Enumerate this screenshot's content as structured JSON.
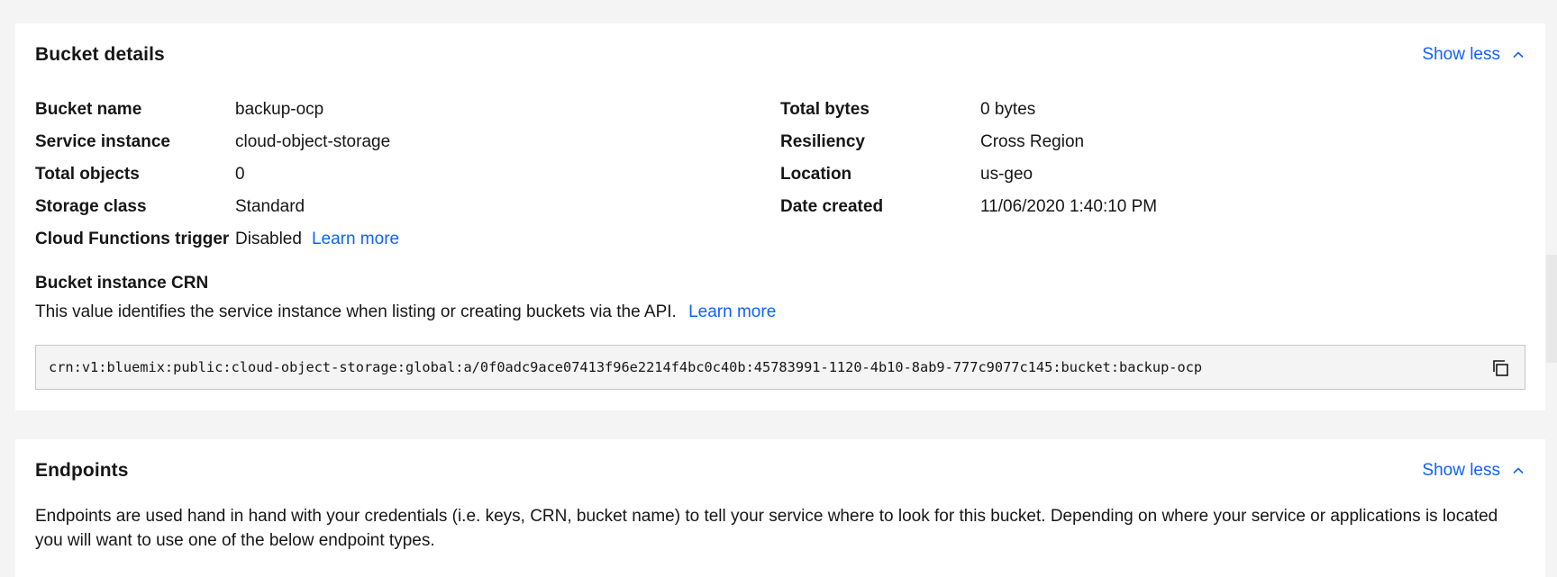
{
  "bucket_details": {
    "title": "Bucket details",
    "toggle_label": "Show less",
    "left": [
      {
        "key": "Bucket name",
        "value": "backup-ocp"
      },
      {
        "key": "Service instance",
        "value": "cloud-object-storage"
      },
      {
        "key": "Total objects",
        "value": "0"
      },
      {
        "key": "Storage class",
        "value": "Standard"
      },
      {
        "key": "Cloud Functions trigger",
        "value": "Disabled",
        "link": "Learn more"
      }
    ],
    "right": [
      {
        "key": "Total bytes",
        "value": "0 bytes"
      },
      {
        "key": "Resiliency",
        "value": "Cross Region"
      },
      {
        "key": "Location",
        "value": "us-geo"
      },
      {
        "key": "Date created",
        "value": "11/06/2020 1:40:10 PM"
      }
    ],
    "crn": {
      "heading": "Bucket instance CRN",
      "description": "This value identifies the service instance when listing or creating buckets via the API.",
      "link": "Learn more",
      "value": "crn:v1:bluemix:public:cloud-object-storage:global:a/0f0adc9ace07413f96e2214f4bc0c40b:45783991-1120-4b10-8ab9-777c9077c145:bucket:backup-ocp",
      "copy_icon": "copy-icon"
    }
  },
  "endpoints": {
    "title": "Endpoints",
    "toggle_label": "Show less",
    "description": "Endpoints are used hand in hand with your credentials (i.e. keys, CRN, bucket name) to tell your service where to look for this bucket. Depending on where your service or applications is located you will want to use one of the below endpoint types."
  },
  "colors": {
    "link": "#0f62fe",
    "background": "#f4f4f4",
    "card": "#ffffff",
    "text": "#161616"
  }
}
